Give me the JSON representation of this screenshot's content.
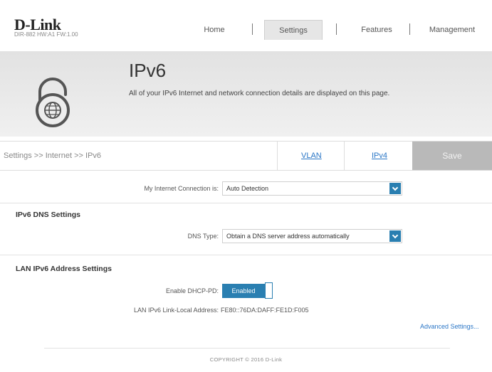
{
  "brand": {
    "logo": "D-Link",
    "model": "DIR-882 HW:A1 FW:1.00"
  },
  "nav": {
    "home": "Home",
    "settings": "Settings",
    "features": "Features",
    "management": "Management",
    "active": "Settings"
  },
  "banner": {
    "title": "IPv6",
    "description": "All of your IPv6 Internet and network connection details are displayed on this page.",
    "icon": "lock-globe-icon"
  },
  "toolbar": {
    "breadcrumb": "Settings >> Internet >> IPv6",
    "vlan": "VLAN",
    "ipv4": "IPv4",
    "save": "Save"
  },
  "connection": {
    "label": "My Internet Connection is:",
    "value": "Auto Detection"
  },
  "dns": {
    "section_title": "IPv6 DNS Settings",
    "type_label": "DNS Type:",
    "type_value": "Obtain a DNS server address automatically"
  },
  "lan": {
    "section_title": "LAN IPv6 Address Settings",
    "dhcp_pd_label": "Enable DHCP-PD:",
    "dhcp_pd_value": "Enabled",
    "link_local_label": "LAN IPv6 Link-Local Address:",
    "link_local_value": "FE80::76DA:DAFF:FE1D:F005"
  },
  "advanced_link": "Advanced Settings...",
  "footer": "COPYRIGHT © 2016 D-Link",
  "colors": {
    "accent": "#2a7fb1",
    "link": "#2a76c6",
    "save_disabled": "#b9b9b9"
  }
}
